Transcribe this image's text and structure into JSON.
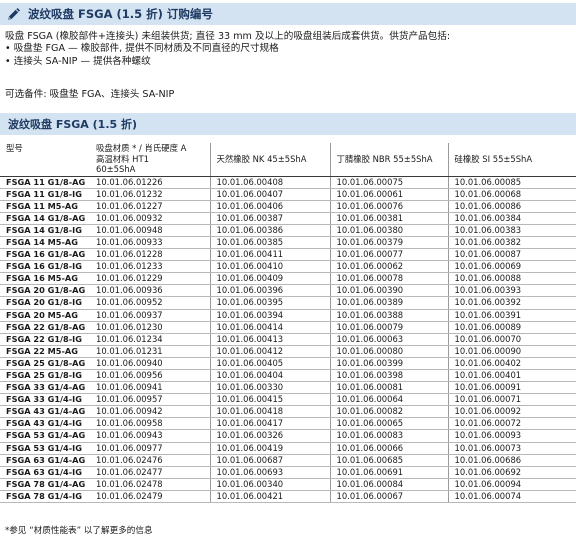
{
  "header": {
    "title": "波纹吸盘 FSGA (1.5 折) 订购编号",
    "icon": "pencil-icon",
    "accent_color": "#d3e3f1",
    "title_color": "#1f3b63"
  },
  "intro": {
    "line1": "吸盘 FSGA (橡胶部件+连接头) 未组装供货; 直径 33 mm 及以上的吸盘组装后成套供货。供货产品包括:",
    "bullet1": "• 吸盘垫 FGA — 橡胶部件, 提供不同材质及不同直径的尺寸规格",
    "bullet2": "• 连接头 SA-NIP — 提供各种螺纹"
  },
  "optional_text": "可选备件: 吸盘垫 FGA、连接头 SA-NIP",
  "section_title": "波纹吸盘 FSGA (1.5 折)",
  "table": {
    "col_model": "型号",
    "material_label": "吸盘材质 * / 肖氏硬度 A",
    "col_ht1_a": "高温材料 HT1",
    "col_ht1_b": "60±5ShA",
    "col_nk": "天然橡胶 NK 45±5ShA",
    "col_nbr": "丁腈橡胶 NBR 55±5ShA",
    "col_si": "硅橡胶 SI 55±5ShA",
    "rows": [
      {
        "model": "FSGA 11 G1/8-AG",
        "ht1": "10.01.06.01226",
        "nk": "10.01.06.00408",
        "nbr": "10.01.06.00075",
        "si": "10.01.06.00085"
      },
      {
        "model": "FSGA 11 G1/8-IG",
        "ht1": "10.01.06.01232",
        "nk": "10.01.06.00407",
        "nbr": "10.01.06.00061",
        "si": "10.01.06.00068"
      },
      {
        "model": "FSGA 11 M5-AG",
        "ht1": "10.01.06.01227",
        "nk": "10.01.06.00406",
        "nbr": "10.01.06.00076",
        "si": "10.01.06.00086"
      },
      {
        "model": "FSGA 14 G1/8-AG",
        "ht1": "10.01.06.00932",
        "nk": "10.01.06.00387",
        "nbr": "10.01.06.00381",
        "si": "10.01.06.00384"
      },
      {
        "model": "FSGA 14 G1/8-IG",
        "ht1": "10.01.06.00948",
        "nk": "10.01.06.00386",
        "nbr": "10.01.06.00380",
        "si": "10.01.06.00383"
      },
      {
        "model": "FSGA 14 M5-AG",
        "ht1": "10.01.06.00933",
        "nk": "10.01.06.00385",
        "nbr": "10.01.06.00379",
        "si": "10.01.06.00382"
      },
      {
        "model": "FSGA 16 G1/8-AG",
        "ht1": "10.01.06.01228",
        "nk": "10.01.06.00411",
        "nbr": "10.01.06.00077",
        "si": "10.01.06.00087"
      },
      {
        "model": "FSGA 16 G1/8-IG",
        "ht1": "10.01.06.01233",
        "nk": "10.01.06.00410",
        "nbr": "10.01.06.00062",
        "si": "10.01.06.00069"
      },
      {
        "model": "FSGA 16 M5-AG",
        "ht1": "10.01.06.01229",
        "nk": "10.01.06.00409",
        "nbr": "10.01.06.00078",
        "si": "10.01.06.00088"
      },
      {
        "model": "FSGA 20 G1/8-AG",
        "ht1": "10.01.06.00936",
        "nk": "10.01.06.00396",
        "nbr": "10.01.06.00390",
        "si": "10.01.06.00393"
      },
      {
        "model": "FSGA 20 G1/8-IG",
        "ht1": "10.01.06.00952",
        "nk": "10.01.06.00395",
        "nbr": "10.01.06.00389",
        "si": "10.01.06.00392"
      },
      {
        "model": "FSGA 20 M5-AG",
        "ht1": "10.01.06.00937",
        "nk": "10.01.06.00394",
        "nbr": "10.01.06.00388",
        "si": "10.01.06.00391"
      },
      {
        "model": "FSGA 22 G1/8-AG",
        "ht1": "10.01.06.01230",
        "nk": "10.01.06.00414",
        "nbr": "10.01.06.00079",
        "si": "10.01.06.00089"
      },
      {
        "model": "FSGA 22 G1/8-IG",
        "ht1": "10.01.06.01234",
        "nk": "10.01.06.00413",
        "nbr": "10.01.06.00063",
        "si": "10.01.06.00070"
      },
      {
        "model": "FSGA 22 M5-AG",
        "ht1": "10.01.06.01231",
        "nk": "10.01.06.00412",
        "nbr": "10.01.06.00080",
        "si": "10.01.06.00090"
      },
      {
        "model": "FSGA 25 G1/8-AG",
        "ht1": "10.01.06.00940",
        "nk": "10.01.06.00405",
        "nbr": "10.01.06.00399",
        "si": "10.01.06.00402"
      },
      {
        "model": "FSGA 25 G1/8-IG",
        "ht1": "10.01.06.00956",
        "nk": "10.01.06.00404",
        "nbr": "10.01.06.00398",
        "si": "10.01.06.00401"
      },
      {
        "model": "FSGA 33 G1/4-AG",
        "ht1": "10.01.06.00941",
        "nk": "10.01.06.00330",
        "nbr": "10.01.06.00081",
        "si": "10.01.06.00091"
      },
      {
        "model": "FSGA 33 G1/4-IG",
        "ht1": "10.01.06.00957",
        "nk": "10.01.06.00415",
        "nbr": "10.01.06.00064",
        "si": "10.01.06.00071"
      },
      {
        "model": "FSGA 43 G1/4-AG",
        "ht1": "10.01.06.00942",
        "nk": "10.01.06.00418",
        "nbr": "10.01.06.00082",
        "si": "10.01.06.00092"
      },
      {
        "model": "FSGA 43 G1/4-IG",
        "ht1": "10.01.06.00958",
        "nk": "10.01.06.00417",
        "nbr": "10.01.06.00065",
        "si": "10.01.06.00072"
      },
      {
        "model": "FSGA 53 G1/4-AG",
        "ht1": "10.01.06.00943",
        "nk": "10.01.06.00326",
        "nbr": "10.01.06.00083",
        "si": "10.01.06.00093"
      },
      {
        "model": "FSGA 53 G1/4-IG",
        "ht1": "10.01.06.00977",
        "nk": "10.01.06.00419",
        "nbr": "10.01.06.00066",
        "si": "10.01.06.00073"
      },
      {
        "model": "FSGA 63 G1/4-AG",
        "ht1": "10.01.06.02476",
        "nk": "10.01.06.00687",
        "nbr": "10.01.06.00685",
        "si": "10.01.06.00686"
      },
      {
        "model": "FSGA 63 G1/4-IG",
        "ht1": "10.01.06.02477",
        "nk": "10.01.06.00693",
        "nbr": "10.01.06.00691",
        "si": "10.01.06.00692"
      },
      {
        "model": "FSGA 78 G1/4-AG",
        "ht1": "10.01.06.02478",
        "nk": "10.01.06.00340",
        "nbr": "10.01.06.00084",
        "si": "10.01.06.00094"
      },
      {
        "model": "FSGA 78 G1/4-IG",
        "ht1": "10.01.06.02479",
        "nk": "10.01.06.00421",
        "nbr": "10.01.06.00067",
        "si": "10.01.06.00074"
      }
    ]
  },
  "footnote": "*参见 “材质性能表” 以了解更多的信息"
}
